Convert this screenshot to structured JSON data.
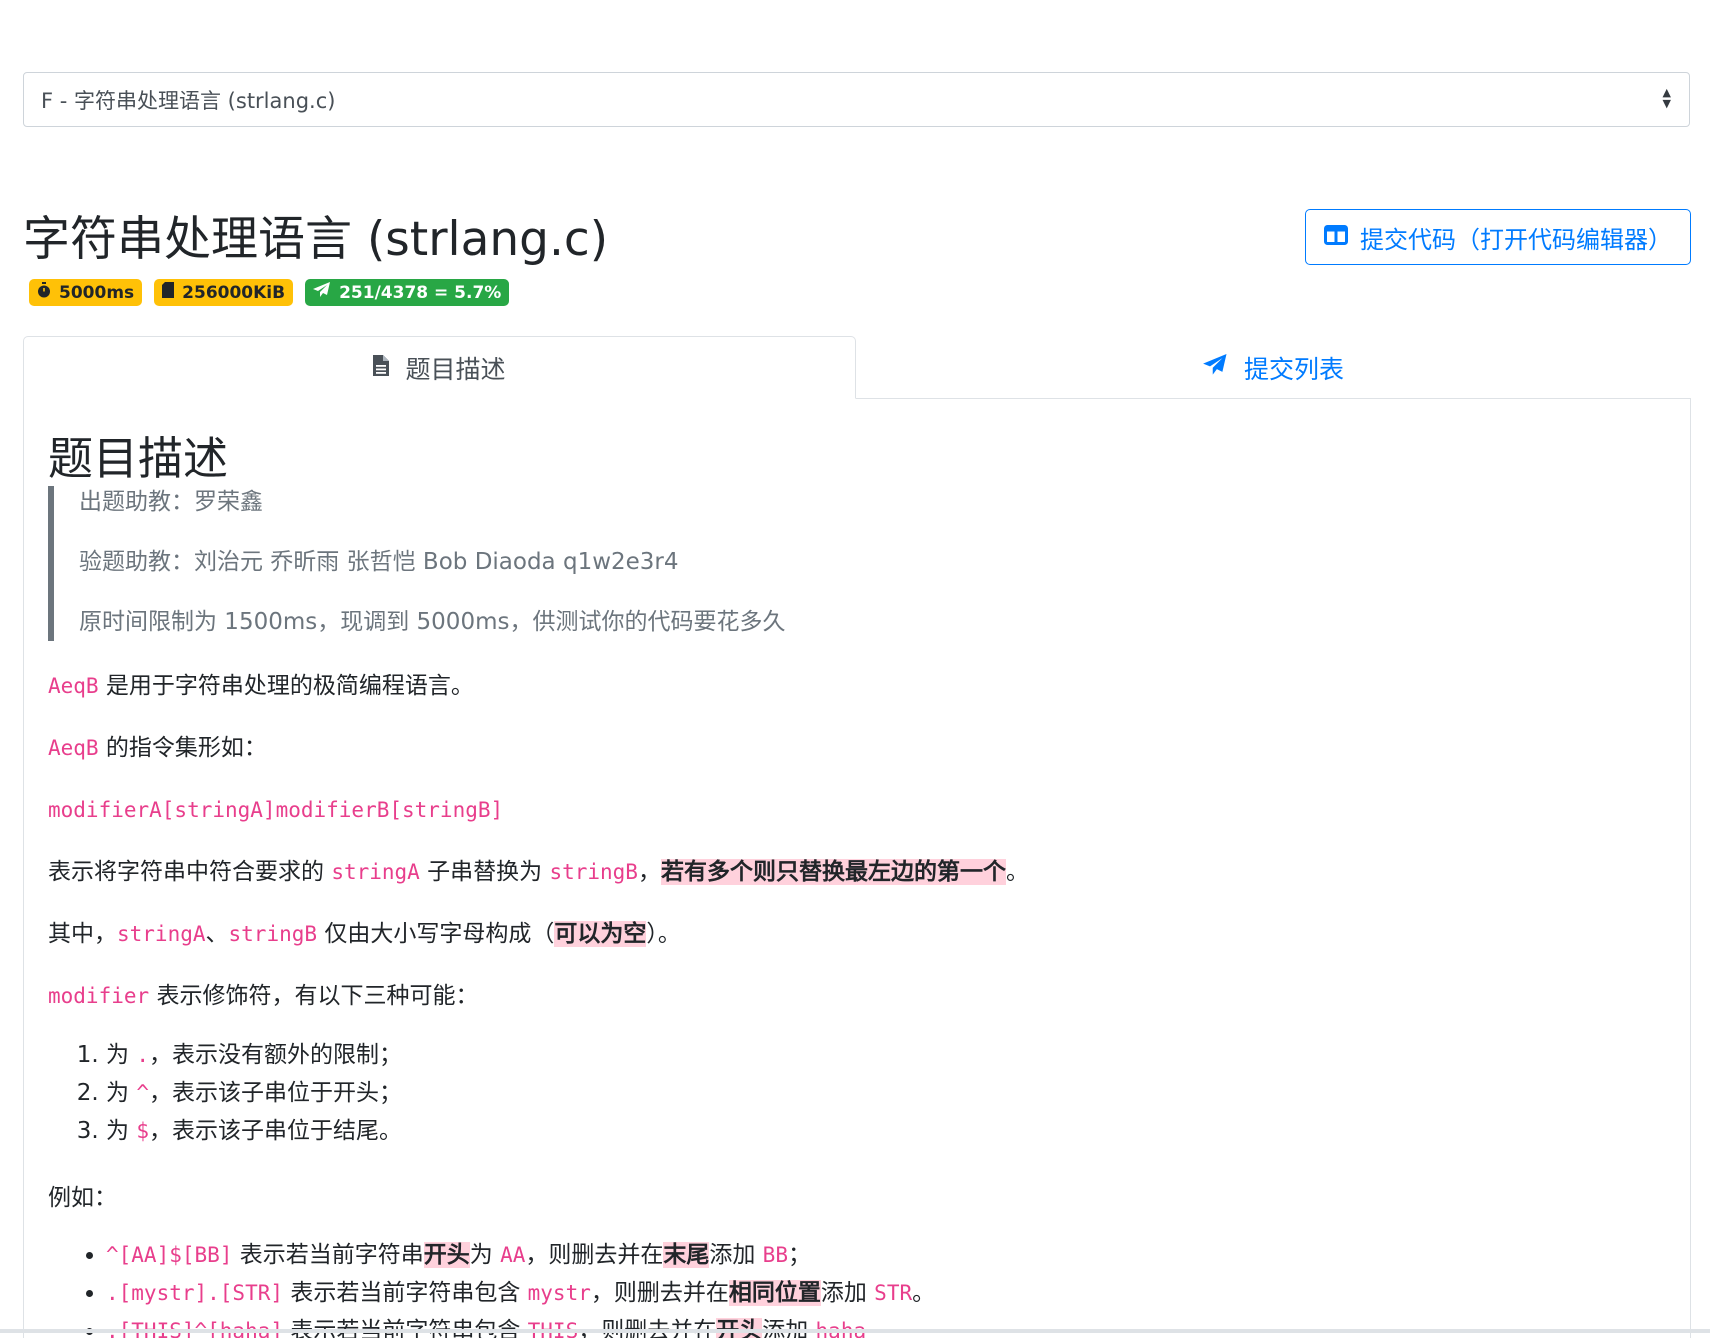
{
  "problem_select": {
    "value": "F - 字符串处理语言 (strlang.c)"
  },
  "header": {
    "title": "字符串处理语言 (strlang.c)",
    "submit_label": "提交代码（打开代码编辑器）"
  },
  "badges": {
    "time": "5000ms",
    "memory": "256000KiB",
    "stats": "251/4378 = 5.7%"
  },
  "tabs": {
    "description": "题目描述",
    "submissions": "提交列表"
  },
  "content": {
    "heading": "题目描述",
    "quote": [
      "出题助教：罗荣鑫",
      "验题助教：刘治元 乔昕雨 张哲恺 Bob Diaoda q1w2e3r4",
      "原时间限制为 1500ms，现调到 5000ms，供测试你的代码要花多久"
    ],
    "p1": {
      "code": "AeqB",
      "text": " 是用于字符串处理的极简编程语言。"
    },
    "p2": {
      "code": "AeqB",
      "text": " 的指令集形如："
    },
    "p3": {
      "code": "modifierA[stringA]modifierB[stringB]"
    },
    "p4": {
      "t1": "表示将字符串中符合要求的 ",
      "c1": "stringA",
      "t2": " 子串替换为 ",
      "c2": "stringB",
      "t3": "，",
      "hl": "若有多个则只替换最左边的第一个",
      "t4": "。"
    },
    "p5": {
      "t1": "其中，",
      "c1": "stringA",
      "t2": "、",
      "c2": "stringB",
      "t3": " 仅由大小写字母构成（",
      "hl": "可以为空",
      "t4": "）。"
    },
    "p6": {
      "code": "modifier",
      "text": " 表示修饰符，有以下三种可能："
    },
    "modifiers": [
      {
        "pre": "为 ",
        "code": ".",
        "post": "，表示没有额外的限制；"
      },
      {
        "pre": "为 ",
        "code": "^",
        "post": "，表示该子串位于开头；"
      },
      {
        "pre": "为 ",
        "code": "$",
        "post": "，表示该子串位于结尾。"
      }
    ],
    "example_intro": "例如：",
    "examples": [
      {
        "c1": "^[AA]$[BB]",
        "t1": " 表示若当前字符串",
        "b1": "开头",
        "t2": "为 ",
        "c2": "AA",
        "t3": "，则删去并在",
        "b2": "末尾",
        "t4": "添加 ",
        "c3": "BB",
        "t5": "；"
      },
      {
        "c1": ".[mystr].[STR]",
        "t1": " 表示若当前字符串包含 ",
        "b1": "",
        "t2": "",
        "c2": "mystr",
        "t3": "，则删去并在",
        "b2": "相同位置",
        "t4": "添加 ",
        "c3": "STR",
        "t5": "。"
      },
      {
        "c1": ".[THIS]^[haha]",
        "t1": " 表示若当前字符串包含 ",
        "b1": "",
        "t2": "",
        "c2": "THIS",
        "t3": "，则删去并在",
        "b2": "开头",
        "t4": "添加 ",
        "c3": "haha",
        "t5": ""
      }
    ]
  }
}
